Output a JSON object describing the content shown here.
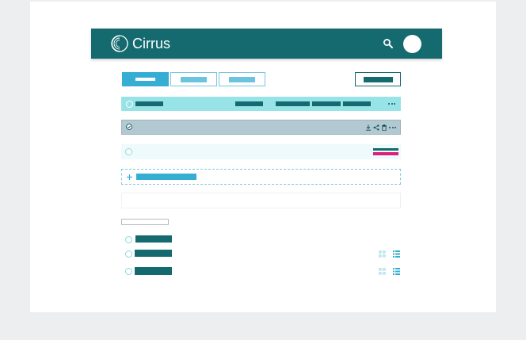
{
  "app": {
    "name": "Cirrus"
  },
  "colors": {
    "brand": "#146a6e",
    "accent": "#36aed3",
    "highlight_row": "#98e3e7",
    "selected_row": "#b3c9d2",
    "hover_row": "#eefafb",
    "magenta": "#d9207e"
  },
  "icons": {
    "logo": "cloud-swirl-icon",
    "search": "search-icon",
    "radio": "radio-circle-icon",
    "check": "check-circle-icon",
    "download": "download-icon",
    "share": "share-icon",
    "trash": "trash-icon",
    "more": "more-horizontal-icon",
    "plus": "plus-icon",
    "grid": "grid-view-icon",
    "list": "list-view-icon"
  }
}
